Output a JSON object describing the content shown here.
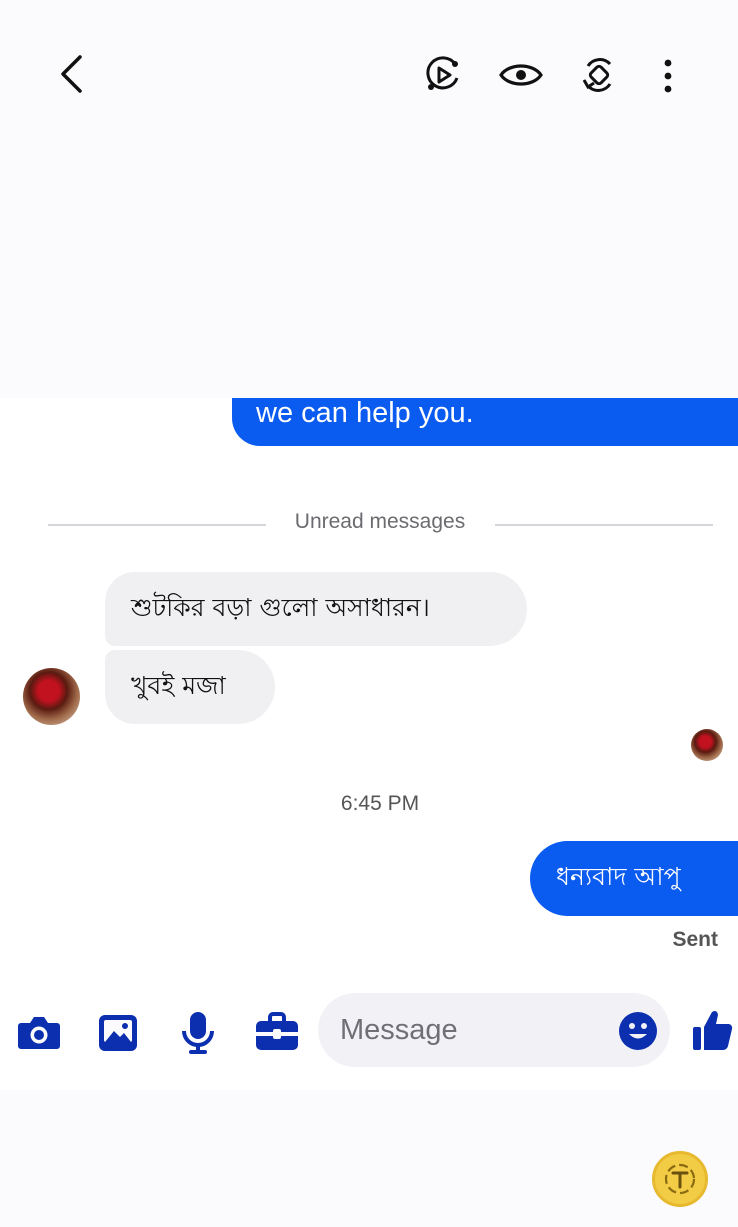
{
  "header": {
    "back_icon": "chevron-left-icon",
    "actions": [
      "play-circle-icon",
      "eye-icon",
      "rotate-icon",
      "more-vertical-icon"
    ]
  },
  "messages": {
    "previous_sent_tail": "we can help you.",
    "unread_divider": "Unread messages",
    "received": [
      "শুটকির বড়া গুলো অসাধারন।",
      "খুবই মজা"
    ],
    "timestamp": "6:45 PM",
    "sent": "ধন্যবাদ আপু",
    "sent_status": "Sent"
  },
  "composer": {
    "placeholder": "Message",
    "tools": [
      "camera-icon",
      "gallery-icon",
      "microphone-icon",
      "briefcase-icon"
    ],
    "emoji_icon": "smiley-icon",
    "like_icon": "thumbs-up-icon"
  },
  "colors": {
    "accent": "#0a5bf0",
    "icon_blue": "#0b2fae",
    "received_bubble": "#f0f0f3",
    "floating_button": "#f2cc44"
  }
}
